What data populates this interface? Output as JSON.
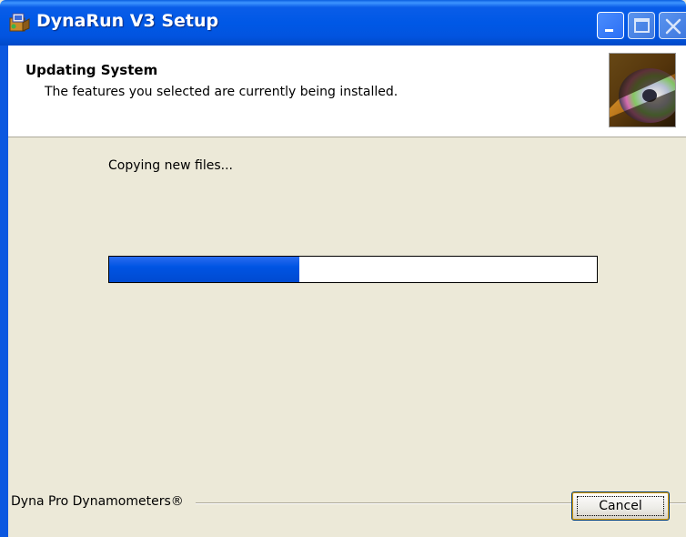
{
  "window": {
    "title": "DynaRun V3 Setup"
  },
  "banner": {
    "title": "Updating System",
    "description": "The features you selected are currently being installed."
  },
  "status": {
    "text": "Copying new files..."
  },
  "progress": {
    "percent": 39
  },
  "footer": {
    "brand": "Dyna Pro Dynamometers®",
    "cancel_label": "Cancel"
  },
  "colors": {
    "titlebar": "#0058e6",
    "progress_fill": "#0054e3",
    "dialog_bg": "#ece9d8"
  },
  "icons": {
    "app": "installer-package-icon",
    "banner": "cd-disc-icon"
  }
}
